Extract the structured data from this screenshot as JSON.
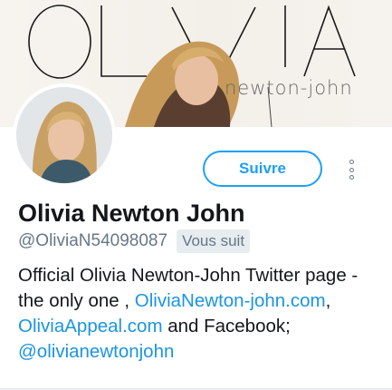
{
  "banner": {
    "big_title": "OLIVIA",
    "subtitle": "newton-john"
  },
  "profile": {
    "name": "Olivia Newton John",
    "handle": "@OliviaN54098087",
    "follows_you_badge": "Vous suit"
  },
  "actions": {
    "follow_label": "Suivre",
    "more_icon": "more-vertical-icon"
  },
  "bio": {
    "text_1": "Official Olivia Newton-John Twitter page - the only one , ",
    "link_1": "OliviaNewton-john.com",
    "text_2": ",",
    "link_2": "OliviaAppeal.com",
    "text_3": " and Facebook;",
    "link_3": "@olivianewtonjohn"
  },
  "colors": {
    "accent": "#1da1f2",
    "link": "#1b95e0",
    "muted": "#657786",
    "brand_pink": "#c2427a"
  }
}
